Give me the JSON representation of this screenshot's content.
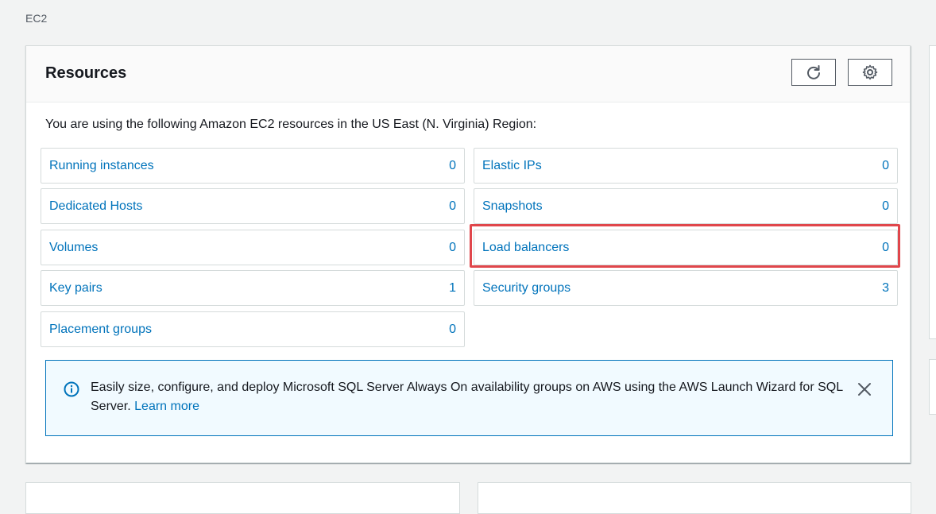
{
  "breadcrumb": "EC2",
  "resources_panel": {
    "title": "Resources",
    "refresh_icon": "refresh-icon",
    "settings_icon": "gear-icon",
    "intro_text": "You are using the following Amazon EC2 resources in the US East (N. Virginia) Region:",
    "left_items": [
      {
        "label": "Running instances",
        "count": "0"
      },
      {
        "label": "Dedicated Hosts",
        "count": "0"
      },
      {
        "label": "Volumes",
        "count": "0"
      },
      {
        "label": "Key pairs",
        "count": "1"
      },
      {
        "label": "Placement groups",
        "count": "0"
      }
    ],
    "right_items": [
      {
        "label": "Elastic IPs",
        "count": "0"
      },
      {
        "label": "Snapshots",
        "count": "0"
      },
      {
        "label": "Load balancers",
        "count": "0"
      },
      {
        "label": "Security groups",
        "count": "3"
      }
    ]
  },
  "info_box": {
    "icon": "info-icon",
    "text": "Easily size, configure, and deploy Microsoft SQL Server Always On availability groups on AWS using the AWS Launch Wizard for SQL Server.",
    "link_label": "Learn more",
    "close_icon": "close-icon"
  },
  "colors": {
    "link": "#0073bb",
    "highlight": "#e0464b",
    "info_border": "#0073bb",
    "info_bg": "#f1faff",
    "page_bg": "#f2f3f3"
  }
}
